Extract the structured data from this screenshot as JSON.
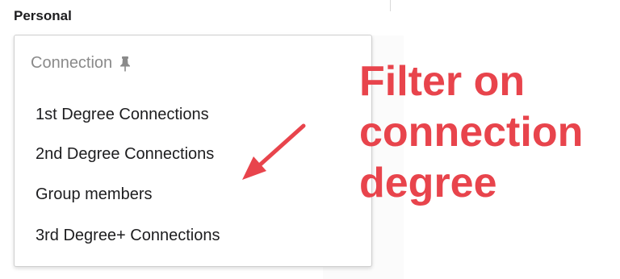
{
  "section": {
    "heading": "Personal"
  },
  "filter": {
    "title": "Connection",
    "options": [
      "1st Degree Connections",
      "2nd Degree Connections",
      "Group members",
      "3rd Degree+ Connections"
    ]
  },
  "annotation": {
    "lines": [
      "Filter on",
      "connection",
      "degree"
    ],
    "color": "#e8444c"
  },
  "icons": {
    "pin": "pin-icon",
    "arrow": "arrow-icon"
  }
}
